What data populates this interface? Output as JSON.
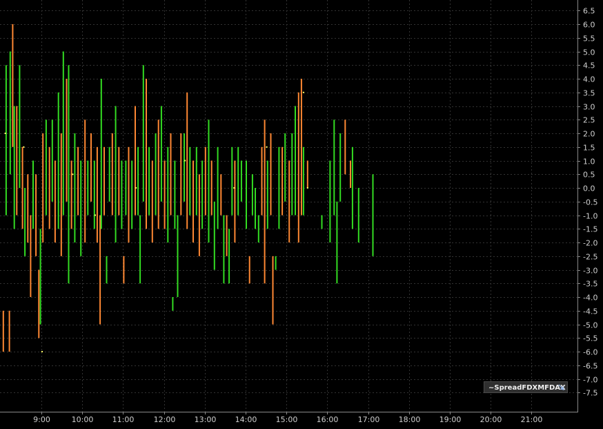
{
  "chart_data": {
    "type": "bar",
    "title": "",
    "xlabel": "",
    "ylabel": "",
    "x_ticks": [
      "9:00",
      "10:00",
      "11:00",
      "12:00",
      "13:00",
      "14:00",
      "15:00",
      "16:00",
      "17:00",
      "18:00",
      "19:00",
      "20:00",
      "21:00"
    ],
    "xlim_hours": [
      8.0,
      21.9
    ],
    "ylim": [
      -7.75,
      6.75
    ],
    "y_ticks": [
      6.5,
      6.0,
      5.5,
      5.0,
      4.5,
      4.0,
      3.5,
      3.0,
      2.5,
      2.0,
      1.5,
      1.0,
      0.5,
      0.0,
      -0.5,
      -1.0,
      -1.5,
      -2.0,
      -2.5,
      -3.0,
      -3.5,
      -4.0,
      -4.5,
      -5.0,
      -5.5,
      -6.0,
      -6.5,
      -7.0,
      -7.5
    ],
    "y_tick_labels": [
      "6.5",
      "6.0",
      "5.5",
      "5.0",
      "4.5",
      "4.0",
      "3.5",
      "3.0",
      "2.5",
      "2.0",
      "1.5",
      "1.0",
      "0.5",
      "0.0",
      "-0.5",
      "-1.0",
      "-1.5",
      "-2.0",
      "-2.5",
      "-3.0",
      "-3.5",
      "-4.0",
      "-4.5",
      "-5.0",
      "-5.5",
      "-6.0",
      "-6.5",
      "-7.0",
      "-7.5"
    ],
    "grid": true,
    "legend_position": "bottom-right",
    "series": [
      {
        "name": "~SpreadFDXMFDAX",
        "colors": {
          "up": "#33dd22",
          "down": "#ff8833",
          "dot": "#ffff66"
        },
        "bars": [
          {
            "t": 8.05,
            "lo": -6.0,
            "hi": -4.5,
            "c": "down"
          },
          {
            "t": 8.12,
            "lo": -1.0,
            "hi": 4.5,
            "c": "up"
          },
          {
            "t": 8.2,
            "lo": -6.0,
            "hi": -4.5,
            "c": "down"
          },
          {
            "t": 8.22,
            "lo": 0.5,
            "hi": 5.0,
            "c": "up"
          },
          {
            "t": 8.28,
            "lo": 1.5,
            "hi": 6.0,
            "c": "down"
          },
          {
            "t": 8.32,
            "lo": -1.5,
            "hi": 3.0,
            "c": "up"
          },
          {
            "t": 8.38,
            "lo": -1.0,
            "hi": 3.0,
            "c": "down"
          },
          {
            "t": 8.45,
            "lo": 0.0,
            "hi": 4.5,
            "c": "up"
          },
          {
            "t": 8.52,
            "lo": -1.5,
            "hi": 1.5,
            "c": "down"
          },
          {
            "t": 8.58,
            "lo": -2.5,
            "hi": 0.0,
            "c": "up"
          },
          {
            "t": 8.65,
            "lo": -2.0,
            "hi": 0.5,
            "c": "down"
          },
          {
            "t": 8.72,
            "lo": -4.0,
            "hi": -1.0,
            "c": "down"
          },
          {
            "t": 8.78,
            "lo": -1.5,
            "hi": 1.0,
            "c": "up"
          },
          {
            "t": 8.85,
            "lo": -2.5,
            "hi": 0.5,
            "c": "down"
          },
          {
            "t": 8.92,
            "lo": -5.5,
            "hi": -3.0,
            "c": "down"
          },
          {
            "t": 8.96,
            "lo": -5.0,
            "hi": -1.5,
            "c": "up"
          },
          {
            "t": 9.02,
            "lo": -2.0,
            "hi": 2.0,
            "c": "down"
          },
          {
            "t": 9.1,
            "lo": -1.0,
            "hi": 2.5,
            "c": "up"
          },
          {
            "t": 9.18,
            "lo": -1.5,
            "hi": 1.5,
            "c": "down"
          },
          {
            "t": 9.25,
            "lo": -0.5,
            "hi": 2.5,
            "c": "up"
          },
          {
            "t": 9.32,
            "lo": -2.0,
            "hi": 1.0,
            "c": "down"
          },
          {
            "t": 9.4,
            "lo": -1.5,
            "hi": 3.5,
            "c": "up"
          },
          {
            "t": 9.47,
            "lo": -2.5,
            "hi": 2.0,
            "c": "down"
          },
          {
            "t": 9.52,
            "lo": -1.0,
            "hi": 5.0,
            "c": "up"
          },
          {
            "t": 9.6,
            "lo": -0.5,
            "hi": 4.0,
            "c": "down"
          },
          {
            "t": 9.65,
            "lo": -3.5,
            "hi": 4.5,
            "c": "up"
          },
          {
            "t": 9.72,
            "lo": -1.5,
            "hi": 1.0,
            "c": "down"
          },
          {
            "t": 9.8,
            "lo": -2.0,
            "hi": 2.0,
            "c": "up"
          },
          {
            "t": 9.88,
            "lo": -1.0,
            "hi": 1.5,
            "c": "down"
          },
          {
            "t": 9.95,
            "lo": -2.5,
            "hi": 1.0,
            "c": "up"
          },
          {
            "t": 10.05,
            "lo": -2.0,
            "hi": 2.5,
            "c": "down"
          },
          {
            "t": 10.12,
            "lo": -1.0,
            "hi": 1.0,
            "c": "up"
          },
          {
            "t": 10.2,
            "lo": -0.5,
            "hi": 2.0,
            "c": "down"
          },
          {
            "t": 10.28,
            "lo": -1.5,
            "hi": 1.0,
            "c": "up"
          },
          {
            "t": 10.35,
            "lo": -2.0,
            "hi": 1.5,
            "c": "down"
          },
          {
            "t": 10.42,
            "lo": -5.0,
            "hi": -1.0,
            "c": "down"
          },
          {
            "t": 10.45,
            "lo": -1.5,
            "hi": 4.0,
            "c": "up"
          },
          {
            "t": 10.52,
            "lo": -1.0,
            "hi": 1.5,
            "c": "down"
          },
          {
            "t": 10.58,
            "lo": -3.5,
            "hi": -2.5,
            "c": "up"
          },
          {
            "t": 10.65,
            "lo": -0.5,
            "hi": 1.5,
            "c": "up"
          },
          {
            "t": 10.72,
            "lo": -1.0,
            "hi": 2.0,
            "c": "down"
          },
          {
            "t": 10.8,
            "lo": -2.0,
            "hi": 3.0,
            "c": "up"
          },
          {
            "t": 10.88,
            "lo": -1.0,
            "hi": 1.5,
            "c": "down"
          },
          {
            "t": 10.95,
            "lo": -1.5,
            "hi": 1.0,
            "c": "up"
          },
          {
            "t": 11.0,
            "lo": -3.5,
            "hi": -2.5,
            "c": "down"
          },
          {
            "t": 11.05,
            "lo": -1.0,
            "hi": 1.0,
            "c": "up"
          },
          {
            "t": 11.12,
            "lo": -2.0,
            "hi": 1.5,
            "c": "down"
          },
          {
            "t": 11.2,
            "lo": -1.5,
            "hi": 1.0,
            "c": "up"
          },
          {
            "t": 11.28,
            "lo": -1.0,
            "hi": 3.0,
            "c": "down"
          },
          {
            "t": 11.35,
            "lo": -1.0,
            "hi": 1.5,
            "c": "up"
          },
          {
            "t": 11.4,
            "lo": -3.5,
            "hi": -1.0,
            "c": "up"
          },
          {
            "t": 11.48,
            "lo": -0.5,
            "hi": 4.5,
            "c": "up"
          },
          {
            "t": 11.55,
            "lo": -1.5,
            "hi": 4.0,
            "c": "down"
          },
          {
            "t": 11.62,
            "lo": -1.0,
            "hi": 1.5,
            "c": "up"
          },
          {
            "t": 11.7,
            "lo": -2.0,
            "hi": 1.0,
            "c": "down"
          },
          {
            "t": 11.78,
            "lo": -1.0,
            "hi": 2.0,
            "c": "up"
          },
          {
            "t": 11.85,
            "lo": -1.5,
            "hi": 2.5,
            "c": "down"
          },
          {
            "t": 11.92,
            "lo": -0.5,
            "hi": 3.0,
            "c": "up"
          },
          {
            "t": 12.0,
            "lo": -1.5,
            "hi": 1.0,
            "c": "down"
          },
          {
            "t": 12.08,
            "lo": -2.0,
            "hi": 1.5,
            "c": "up"
          },
          {
            "t": 12.15,
            "lo": -1.0,
            "hi": 2.0,
            "c": "down"
          },
          {
            "t": 12.2,
            "lo": -4.5,
            "hi": -4.0,
            "c": "up"
          },
          {
            "t": 12.25,
            "lo": -1.5,
            "hi": 1.0,
            "c": "up"
          },
          {
            "t": 12.32,
            "lo": -4.0,
            "hi": -1.0,
            "c": "up"
          },
          {
            "t": 12.4,
            "lo": -1.0,
            "hi": 2.0,
            "c": "down"
          },
          {
            "t": 12.48,
            "lo": -0.5,
            "hi": 2.0,
            "c": "up"
          },
          {
            "t": 12.55,
            "lo": -1.5,
            "hi": 3.5,
            "c": "down"
          },
          {
            "t": 12.62,
            "lo": -1.0,
            "hi": 1.5,
            "c": "up"
          },
          {
            "t": 12.7,
            "lo": -2.0,
            "hi": 1.0,
            "c": "down"
          },
          {
            "t": 12.78,
            "lo": -1.0,
            "hi": 1.5,
            "c": "up"
          },
          {
            "t": 12.85,
            "lo": -2.5,
            "hi": 0.5,
            "c": "down"
          },
          {
            "t": 12.92,
            "lo": -1.5,
            "hi": 1.0,
            "c": "up"
          },
          {
            "t": 13.0,
            "lo": -1.0,
            "hi": 1.5,
            "c": "down"
          },
          {
            "t": 13.08,
            "lo": -2.0,
            "hi": 2.5,
            "c": "up"
          },
          {
            "t": 13.15,
            "lo": -1.0,
            "hi": 1.0,
            "c": "down"
          },
          {
            "t": 13.22,
            "lo": -3.0,
            "hi": -0.5,
            "c": "up"
          },
          {
            "t": 13.3,
            "lo": -1.5,
            "hi": 1.5,
            "c": "up"
          },
          {
            "t": 13.38,
            "lo": -1.0,
            "hi": 0.5,
            "c": "down"
          },
          {
            "t": 13.45,
            "lo": -3.5,
            "hi": -1.0,
            "c": "up"
          },
          {
            "t": 13.52,
            "lo": -2.5,
            "hi": -1.0,
            "c": "down"
          },
          {
            "t": 13.58,
            "lo": -3.5,
            "hi": -1.5,
            "c": "up"
          },
          {
            "t": 13.65,
            "lo": -1.0,
            "hi": 1.5,
            "c": "up"
          },
          {
            "t": 13.72,
            "lo": -2.0,
            "hi": 1.0,
            "c": "down"
          },
          {
            "t": 13.8,
            "lo": -1.0,
            "hi": 1.5,
            "c": "up"
          },
          {
            "t": 13.88,
            "lo": -0.5,
            "hi": 1.0,
            "c": "up"
          },
          {
            "t": 14.0,
            "lo": -1.5,
            "hi": 1.0,
            "c": "up"
          },
          {
            "t": 14.08,
            "lo": -3.5,
            "hi": -2.5,
            "c": "down"
          },
          {
            "t": 14.15,
            "lo": -1.0,
            "hi": 0.5,
            "c": "up"
          },
          {
            "t": 14.22,
            "lo": -1.5,
            "hi": 0.0,
            "c": "up"
          },
          {
            "t": 14.3,
            "lo": -2.0,
            "hi": -1.0,
            "c": "up"
          },
          {
            "t": 14.38,
            "lo": -1.0,
            "hi": 1.5,
            "c": "down"
          },
          {
            "t": 14.45,
            "lo": -3.5,
            "hi": 2.5,
            "c": "down"
          },
          {
            "t": 14.52,
            "lo": -1.5,
            "hi": 1.0,
            "c": "up"
          },
          {
            "t": 14.6,
            "lo": -1.0,
            "hi": 2.0,
            "c": "down"
          },
          {
            "t": 14.65,
            "lo": -5.0,
            "hi": -2.5,
            "c": "down"
          },
          {
            "t": 14.72,
            "lo": -3.0,
            "hi": -2.5,
            "c": "up"
          },
          {
            "t": 14.8,
            "lo": -1.5,
            "hi": 1.5,
            "c": "up"
          },
          {
            "t": 14.88,
            "lo": -1.0,
            "hi": 1.5,
            "c": "down"
          },
          {
            "t": 14.95,
            "lo": -0.5,
            "hi": 2.0,
            "c": "up"
          },
          {
            "t": 15.05,
            "lo": -2.0,
            "hi": 1.0,
            "c": "down"
          },
          {
            "t": 15.12,
            "lo": -1.0,
            "hi": 2.0,
            "c": "up"
          },
          {
            "t": 15.2,
            "lo": -1.0,
            "hi": 3.0,
            "c": "up"
          },
          {
            "t": 15.28,
            "lo": -2.0,
            "hi": 3.5,
            "c": "down"
          },
          {
            "t": 15.35,
            "lo": -1.0,
            "hi": 4.0,
            "c": "down"
          },
          {
            "t": 15.4,
            "lo": -1.0,
            "hi": 1.5,
            "c": "up"
          },
          {
            "t": 15.5,
            "lo": 0.0,
            "hi": 1.0,
            "c": "down"
          },
          {
            "t": 15.85,
            "lo": -1.5,
            "hi": -1.0,
            "c": "up"
          },
          {
            "t": 16.05,
            "lo": -2.0,
            "hi": 1.0,
            "c": "up"
          },
          {
            "t": 16.15,
            "lo": -1.0,
            "hi": 2.5,
            "c": "up"
          },
          {
            "t": 16.22,
            "lo": -3.5,
            "hi": -0.5,
            "c": "up"
          },
          {
            "t": 16.3,
            "lo": -0.5,
            "hi": 2.0,
            "c": "up"
          },
          {
            "t": 16.42,
            "lo": 0.5,
            "hi": 2.5,
            "c": "down"
          },
          {
            "t": 16.55,
            "lo": 0.0,
            "hi": 1.0,
            "c": "down"
          },
          {
            "t": 16.6,
            "lo": -1.5,
            "hi": 1.5,
            "c": "up"
          },
          {
            "t": 16.75,
            "lo": -2.0,
            "hi": 0.0,
            "c": "up"
          },
          {
            "t": 17.1,
            "lo": -2.5,
            "hi": 0.5,
            "c": "up"
          }
        ],
        "dots": [
          {
            "t": 8.1,
            "y": 2.0
          },
          {
            "t": 8.55,
            "y": 1.5
          },
          {
            "t": 9.0,
            "y": -6.0
          },
          {
            "t": 9.75,
            "y": 0.5
          },
          {
            "t": 10.3,
            "y": -1.0
          },
          {
            "t": 11.3,
            "y": 0.0
          },
          {
            "t": 12.5,
            "y": 1.0
          },
          {
            "t": 13.7,
            "y": 0.0
          },
          {
            "t": 14.5,
            "y": 1.5
          },
          {
            "t": 15.4,
            "y": 3.5
          },
          {
            "t": 15.5,
            "y": 0.0
          }
        ]
      }
    ]
  },
  "legend": {
    "label": "~SpreadFDXMFDAX"
  }
}
